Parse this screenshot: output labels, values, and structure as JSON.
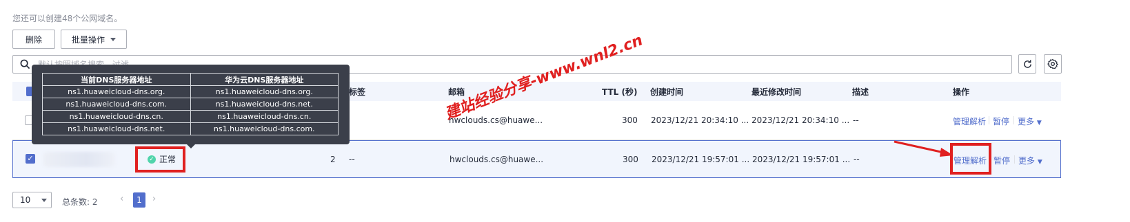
{
  "header": {
    "hint": "您还可以创建48个公网域名。"
  },
  "toolbar": {
    "delete_label": "删除",
    "batch_label": "批量操作"
  },
  "search": {
    "placeholder": "默认按照域名搜索、过滤"
  },
  "table": {
    "columns": {
      "tag": "标签",
      "email": "邮箱",
      "ttl": "TTL (秒)",
      "created": "创建时间",
      "modified": "最近修改时间",
      "desc": "描述",
      "ops": "操作"
    },
    "rows": [
      {
        "email": "hwclouds.cs@huawe...",
        "ttl": "300",
        "created": "2023/12/21 20:34:10 ...",
        "modified": "2023/12/21 20:34:10 ...",
        "desc": "--"
      },
      {
        "status": "正常",
        "records": "2",
        "tag": "--",
        "email": "hwclouds.cs@huawe...",
        "ttl": "300",
        "created": "2023/12/21 19:57:01 ...",
        "modified": "2023/12/21 19:57:01 ...",
        "desc": "--"
      }
    ],
    "actions": {
      "manage": "管理解析",
      "pause": "暂停",
      "more": "更多"
    }
  },
  "tooltip": {
    "headers": [
      "当前DNS服务器地址",
      "华为云DNS服务器地址"
    ],
    "rows": [
      [
        "ns1.huaweicloud-dns.org.",
        "ns1.huaweicloud-dns.org."
      ],
      [
        "ns1.huaweicloud-dns.com.",
        "ns1.huaweicloud-dns.net."
      ],
      [
        "ns1.huaweicloud-dns.cn.",
        "ns1.huaweicloud-dns.cn."
      ],
      [
        "ns1.huaweicloud-dns.net.",
        "ns1.huaweicloud-dns.com."
      ]
    ]
  },
  "watermark": "建站经验分享-www.wnl2.cn",
  "pagination": {
    "page_size": "10",
    "total_label": "总条数: 2",
    "current_page": "1"
  },
  "colors": {
    "accent": "#526ecc",
    "highlight": "#e02020",
    "success": "#50d4ab"
  }
}
